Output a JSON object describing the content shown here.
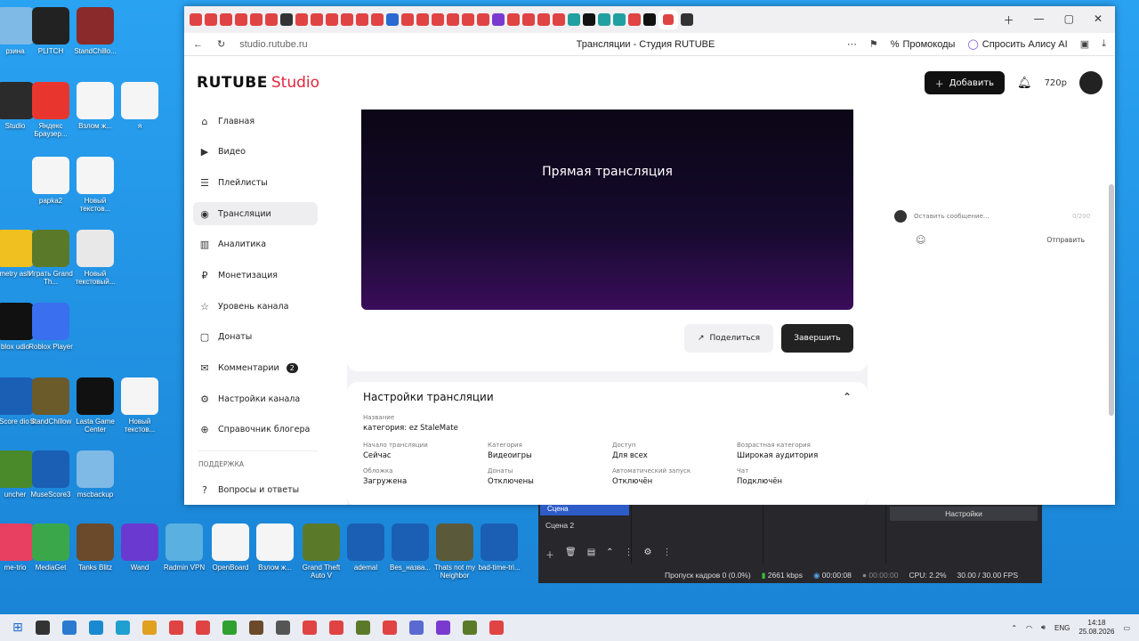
{
  "desktop": {
    "icons": [
      {
        "label": "рзина",
        "color": "#7fb9e6"
      },
      {
        "label": "PLITCH",
        "color": "#222222"
      },
      {
        "label": "StandChillo...",
        "color": "#8a2a2a"
      },
      {
        "label": "Studio",
        "color": "#2b2b2b"
      },
      {
        "label": "Яндекс Браузер...",
        "color": "#e8362f"
      },
      {
        "label": "Взлом ж...",
        "color": "#f5f5f5"
      },
      {
        "label": "я",
        "color": "#f5f5f5"
      },
      {
        "label": "papka2",
        "color": "#f5f5f5"
      },
      {
        "label": "Новый текстов...",
        "color": "#f5f5f5"
      },
      {
        "label": "metry ash",
        "color": "#f0c020"
      },
      {
        "label": "Играть Grand Th...",
        "color": "#5a7a2a"
      },
      {
        "label": "Новый текстовый...",
        "color": "#e8e8e8"
      },
      {
        "label": "blox udio",
        "color": "#111111"
      },
      {
        "label": "Roblox Player",
        "color": "#3a6ff0"
      },
      {
        "label": "eScore dio 4",
        "color": "#1a5fb4"
      },
      {
        "label": "StandChillow",
        "color": "#6b5a2a"
      },
      {
        "label": "Lasta Game Center",
        "color": "#111111"
      },
      {
        "label": "Новый текстов...",
        "color": "#f5f5f5"
      },
      {
        "label": "uncher",
        "color": "#4a8a2a"
      },
      {
        "label": "MuseScore3",
        "color": "#1a5fb4"
      },
      {
        "label": "mscbackup",
        "color": "#7fb9e6"
      }
    ],
    "bottom_icons": [
      {
        "label": "me-trio",
        "color": "#e84060"
      },
      {
        "label": "MediaGet",
        "color": "#3aa84a"
      },
      {
        "label": "Tanks Blitz",
        "color": "#6a4a2a"
      },
      {
        "label": "Wand",
        "color": "#6a3ad0"
      },
      {
        "label": "Radmin VPN",
        "color": "#5ab0e0"
      },
      {
        "label": "OpenBoard",
        "color": "#f5f5f5"
      },
      {
        "label": "Взлом ж...",
        "color": "#f5f5f5"
      },
      {
        "label": "Grand Theft Auto V",
        "color": "#5a7a2a"
      },
      {
        "label": "ademal",
        "color": "#1a5fb4"
      },
      {
        "label": "Bes_назва...",
        "color": "#1a5fb4"
      },
      {
        "label": "Thats not my Neighbor",
        "color": "#5a5a3a"
      },
      {
        "label": "bad-time-tri...",
        "color": "#1a5fb4"
      }
    ]
  },
  "browser": {
    "url": "studio.rutube.ru",
    "title": "Трансляции - Студия RUTUBE",
    "promo": "Промокоды",
    "alice": "Спросить Алису AI",
    "tab_colors": [
      "#e04343",
      "#e04343",
      "#e04343",
      "#e04343",
      "#e04343",
      "#e04343",
      "#333333",
      "#e04343",
      "#e04343",
      "#e04343",
      "#e04343",
      "#e04343",
      "#e04343",
      "#2a6ad0",
      "#e04343",
      "#e04343",
      "#e04343",
      "#e04343",
      "#e04343",
      "#e04343",
      "#7a3ad0",
      "#e04343",
      "#e04343",
      "#e04343",
      "#e04343",
      "#20a0a0",
      "#111111",
      "#20a0a0",
      "#20a0a0",
      "#e04343",
      "#111111",
      "#333333"
    ]
  },
  "studio": {
    "logo": "RUTUBE",
    "logo_sub": "Studio",
    "add_label": "Добавить",
    "quality": "720p"
  },
  "sidebar": {
    "items": [
      {
        "label": "Главная",
        "icon": "⌂"
      },
      {
        "label": "Видео",
        "icon": "▶"
      },
      {
        "label": "Плейлисты",
        "icon": "☰"
      },
      {
        "label": "Трансляции",
        "icon": "◉"
      },
      {
        "label": "Аналитика",
        "icon": "▥"
      },
      {
        "label": "Монетизация",
        "icon": "₽"
      },
      {
        "label": "Уровень канала",
        "icon": "☆"
      },
      {
        "label": "Донаты",
        "icon": "▢"
      },
      {
        "label": "Комментарии",
        "icon": "✉",
        "badge": "2"
      },
      {
        "label": "Настройки канала",
        "icon": "⚙"
      },
      {
        "label": "Справочник блогера",
        "icon": "⊕"
      }
    ],
    "support_title": "ПОДДЕРЖКА",
    "faq": "Вопросы и ответы"
  },
  "player": {
    "title": "Прямая трансляция",
    "share": "Поделиться",
    "end": "Завершить"
  },
  "settings": {
    "title": "Настройки трансляции",
    "name_label": "Название",
    "name_value": "категория: ez StaleMate",
    "fields": [
      {
        "label": "Начало трансляции",
        "value": "Сейчас"
      },
      {
        "label": "Категория",
        "value": "Видеоигры"
      },
      {
        "label": "Доступ",
        "value": "Для всех"
      },
      {
        "label": "Возрастная категория",
        "value": "Широкая аудитория"
      },
      {
        "label": "Обложка",
        "value": "Загружена"
      },
      {
        "label": "Донаты",
        "value": "Отключены"
      },
      {
        "label": "Автоматический запуск",
        "value": "Отключён"
      },
      {
        "label": "Чат",
        "value": "Подключён"
      }
    ]
  },
  "chat": {
    "placeholder": "Оставить сообщение...",
    "count": "0/200",
    "send": "Отправить"
  },
  "obs": {
    "scene1": "Сцена",
    "scene2": "Сцена 2",
    "settings": "Настройки",
    "dropped": "Пропуск кадров 0 (0.0%)",
    "bitrate": "2661 kbps",
    "time1": "00:00:08",
    "time2": "00:00:00",
    "cpu": "CPU: 2.2%",
    "fps": "30.00 / 30.00 FPS"
  },
  "taskbar": {
    "lang": "ENG",
    "time": "14:18",
    "date": "25.08.2026",
    "app_colors": [
      "#333333",
      "#2a7ad0",
      "#1a8ad0",
      "#20a0d0",
      "#e0a020",
      "#e04343",
      "#e04343",
      "#30a030",
      "#6a4a2a",
      "#555555",
      "#e04343",
      "#e04343",
      "#5a7a2a",
      "#e04343",
      "#5a6ad0",
      "#7a3ad0",
      "#5a7a2a",
      "#e04343"
    ]
  }
}
